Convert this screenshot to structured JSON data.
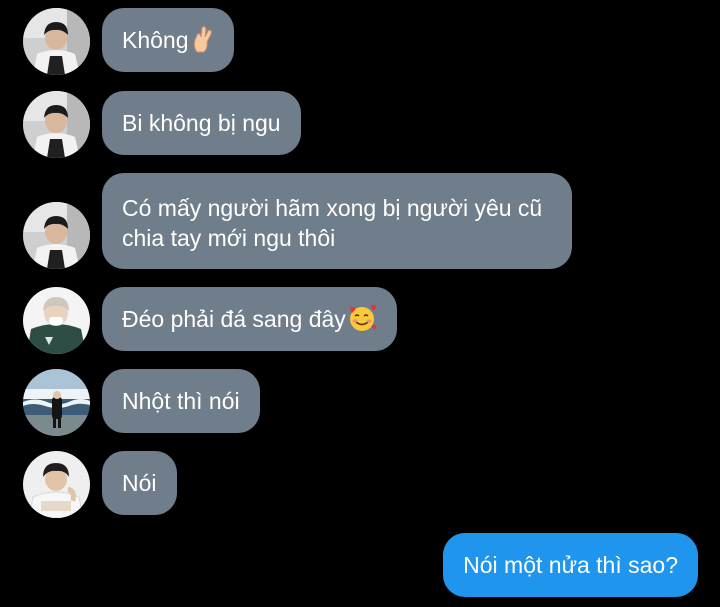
{
  "messages": [
    {
      "sender": "friend-1",
      "text": "Không",
      "emoji": "crossed-fingers-emoji",
      "direction": "in"
    },
    {
      "sender": "friend-1",
      "text": "Bi không bị ngu",
      "direction": "in"
    },
    {
      "sender": "friend-1",
      "text": "Có mấy người hãm xong bị người yêu cũ chia tay mới ngu thôi",
      "direction": "in"
    },
    {
      "sender": "friend-2",
      "text": "Đéo phải đá sang đây",
      "emoji": "smiling-face-with-hearts-emoji",
      "direction": "in"
    },
    {
      "sender": "friend-3",
      "text": "Nhột thì nói",
      "direction": "in"
    },
    {
      "sender": "friend-4",
      "text": "Nói",
      "direction": "in"
    },
    {
      "sender": "me",
      "text": "Nói một nửa thì sao?",
      "direction": "out"
    }
  ],
  "colors": {
    "background": "#000000",
    "incoming_bubble": "#707e8b",
    "outgoing_bubble": "#1f95ee",
    "text": "#ffffff"
  }
}
